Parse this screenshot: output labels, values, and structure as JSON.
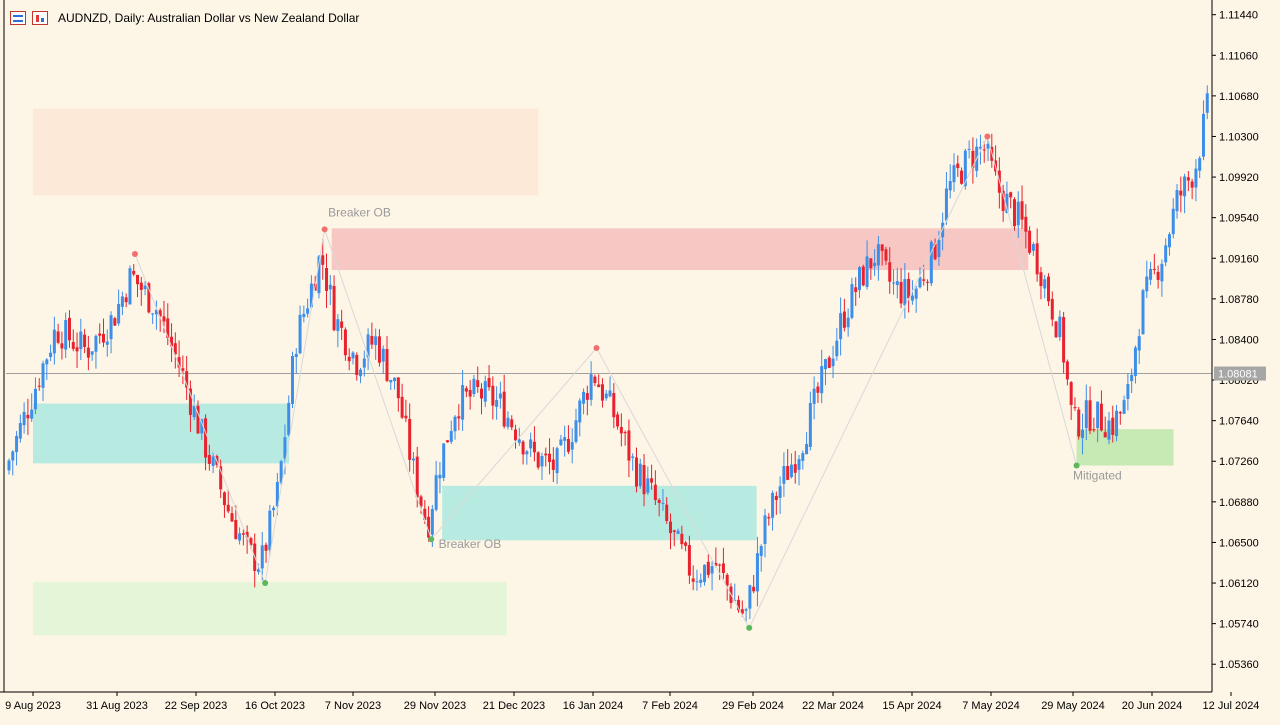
{
  "header": {
    "symbol_line": "AUDNZD, Daily:  Australian Dollar vs New Zealand Dollar"
  },
  "chart_data": {
    "type": "candlestick",
    "symbol": "AUDNZD",
    "timeframe": "Daily",
    "description": "Australian Dollar vs New Zealand Dollar",
    "ylim": [
      1.051,
      1.1154
    ],
    "y_ticks": [
      "1.11440",
      "1.11060",
      "1.10680",
      "1.10300",
      "1.09920",
      "1.09540",
      "1.09160",
      "1.08780",
      "1.08400",
      "1.08020",
      "1.07640",
      "1.07260",
      "1.06880",
      "1.06500",
      "1.06120",
      "1.05740",
      "1.05360"
    ],
    "x_ticks": [
      "9 Aug 2023",
      "31 Aug 2023",
      "22 Sep 2023",
      "16 Oct 2023",
      "7 Nov 2023",
      "29 Nov 2023",
      "21 Dec 2023",
      "16 Jan 2024",
      "7 Feb 2024",
      "29 Feb 2024",
      "22 Mar 2024",
      "15 Apr 2024",
      "7 May 2024",
      "29 May 2024",
      "20 Jun 2024",
      "12 Jul 2024"
    ],
    "current_price": "1.08081",
    "colors": {
      "background": "#fdf5e6",
      "bull": "#3d8ee8",
      "bear": "#e8222e",
      "tick_text": "#000000",
      "zigzag": "#d9d9d9"
    },
    "zones": [
      {
        "name": "bearish-ob-zone-1",
        "from": "9 Aug 2023",
        "to": "29 Dec 2023",
        "low": 1.0975,
        "high": 1.1056,
        "color": "#fde9d7"
      },
      {
        "name": "breaker-zone-top",
        "from": "1 Nov 2023",
        "to": "17 May 2024",
        "low": 1.0905,
        "high": 1.0944,
        "color": "#f7c7c3"
      },
      {
        "name": "bullish-zone-left",
        "from": "9 Aug 2023",
        "to": "20 Oct 2023",
        "low": 1.0724,
        "high": 1.078,
        "color": "#b7ebe1"
      },
      {
        "name": "breaker-zone-bottom",
        "from": "1 Dec 2023",
        "to": "1 Mar 2024",
        "low": 1.0652,
        "high": 1.0703,
        "color": "#b7ebe1"
      },
      {
        "name": "bullish-zone-lower-left",
        "from": "9 Aug 2023",
        "to": "19 Dec 2023",
        "low": 1.0563,
        "high": 1.0613,
        "color": "#e5f6d8"
      },
      {
        "name": "mitigated-zone",
        "from": "30 May 2024",
        "to": "26 Jun 2024",
        "low": 1.0722,
        "high": 1.0756,
        "color": "#c7e9b4"
      }
    ],
    "annotations": [
      {
        "name": "breaker-ob-label-top",
        "text": "Breaker OB",
        "date": "31 Oct 2023",
        "price": 1.0955
      },
      {
        "name": "breaker-ob-label-bottom",
        "text": "Breaker OB",
        "date": "30 Nov 2023",
        "price": 1.0645
      },
      {
        "name": "mitigated-label",
        "text": "Mitigated",
        "date": "29 May 2024",
        "price": 1.0709
      }
    ],
    "swing_points": [
      {
        "date": "5 Sep 2023",
        "price": 1.092,
        "kind": "high"
      },
      {
        "date": "13 Oct 2023",
        "price": 1.0612,
        "kind": "low"
      },
      {
        "date": "30 Oct 2023",
        "price": 1.0943,
        "kind": "high"
      },
      {
        "date": "28 Nov 2023",
        "price": 1.0653,
        "kind": "low"
      },
      {
        "date": "17 Jan 2024",
        "price": 1.0832,
        "kind": "high"
      },
      {
        "date": "28 Feb 2024",
        "price": 1.057,
        "kind": "low"
      },
      {
        "date": "6 May 2024",
        "price": 1.103,
        "kind": "high"
      },
      {
        "date": "30 May 2024",
        "price": 1.0722,
        "kind": "low"
      }
    ],
    "price_path": [
      [
        "9 Aug 2023",
        1.078
      ],
      [
        "16 Aug 2023",
        1.085
      ],
      [
        "24 Aug 2023",
        1.083
      ],
      [
        "31 Aug 2023",
        1.086
      ],
      [
        "5 Sep 2023",
        1.09
      ],
      [
        "12 Sep 2023",
        1.087
      ],
      [
        "19 Sep 2023",
        1.081
      ],
      [
        "26 Sep 2023",
        1.074
      ],
      [
        "3 Oct 2023",
        1.068
      ],
      [
        "9 Oct 2023",
        1.064
      ],
      [
        "13 Oct 2023",
        1.063
      ],
      [
        "18 Oct 2023",
        1.07
      ],
      [
        "23 Oct 2023",
        1.084
      ],
      [
        "30 Oct 2023",
        1.092
      ],
      [
        "3 Nov 2023",
        1.086
      ],
      [
        "9 Nov 2023",
        1.082
      ],
      [
        "14 Nov 2023",
        1.084
      ],
      [
        "20 Nov 2023",
        1.079
      ],
      [
        "24 Nov 2023",
        1.072
      ],
      [
        "28 Nov 2023",
        1.0665
      ],
      [
        "1 Dec 2023",
        1.072
      ],
      [
        "6 Dec 2023",
        1.078
      ],
      [
        "12 Dec 2023",
        1.079
      ],
      [
        "18 Dec 2023",
        1.078
      ],
      [
        "22 Dec 2023",
        1.076
      ],
      [
        "29 Dec 2023",
        1.073
      ],
      [
        "5 Jan 2024",
        1.072
      ],
      [
        "11 Jan 2024",
        1.076
      ],
      [
        "17 Jan 2024",
        1.081
      ],
      [
        "23 Jan 2024",
        1.077
      ],
      [
        "29 Jan 2024",
        1.072
      ],
      [
        "2 Feb 2024",
        1.07
      ],
      [
        "8 Feb 2024",
        1.066
      ],
      [
        "14 Feb 2024",
        1.062
      ],
      [
        "20 Feb 2024",
        1.063
      ],
      [
        "26 Feb 2024",
        1.059
      ],
      [
        "28 Feb 2024",
        1.058
      ],
      [
        "4 Mar 2024",
        1.066
      ],
      [
        "8 Mar 2024",
        1.07
      ],
      [
        "14 Mar 2024",
        1.074
      ],
      [
        "20 Mar 2024",
        1.08
      ],
      [
        "26 Mar 2024",
        1.086
      ],
      [
        "1 Apr 2024",
        1.09
      ],
      [
        "5 Apr 2024",
        1.092
      ],
      [
        "10 Apr 2024",
        1.089
      ],
      [
        "16 Apr 2024",
        1.088
      ],
      [
        "22 Apr 2024",
        1.092
      ],
      [
        "26 Apr 2024",
        1.098
      ],
      [
        "2 May 2024",
        1.101
      ],
      [
        "6 May 2024",
        1.102
      ],
      [
        "10 May 2024",
        1.098
      ],
      [
        "16 May 2024",
        1.095
      ],
      [
        "21 May 2024",
        1.091
      ],
      [
        "27 May 2024",
        1.084
      ],
      [
        "30 May 2024",
        1.076
      ],
      [
        "4 Jun 2024",
        1.077
      ],
      [
        "10 Jun 2024",
        1.076
      ],
      [
        "14 Jun 2024",
        1.078
      ],
      [
        "18 Jun 2024",
        1.087
      ],
      [
        "24 Jun 2024",
        1.092
      ],
      [
        "28 Jun 2024",
        1.097
      ],
      [
        "3 Jul 2024",
        1.1
      ],
      [
        "8 Jul 2024",
        1.108
      ],
      [
        "12 Jul 2024",
        1.112
      ]
    ]
  }
}
